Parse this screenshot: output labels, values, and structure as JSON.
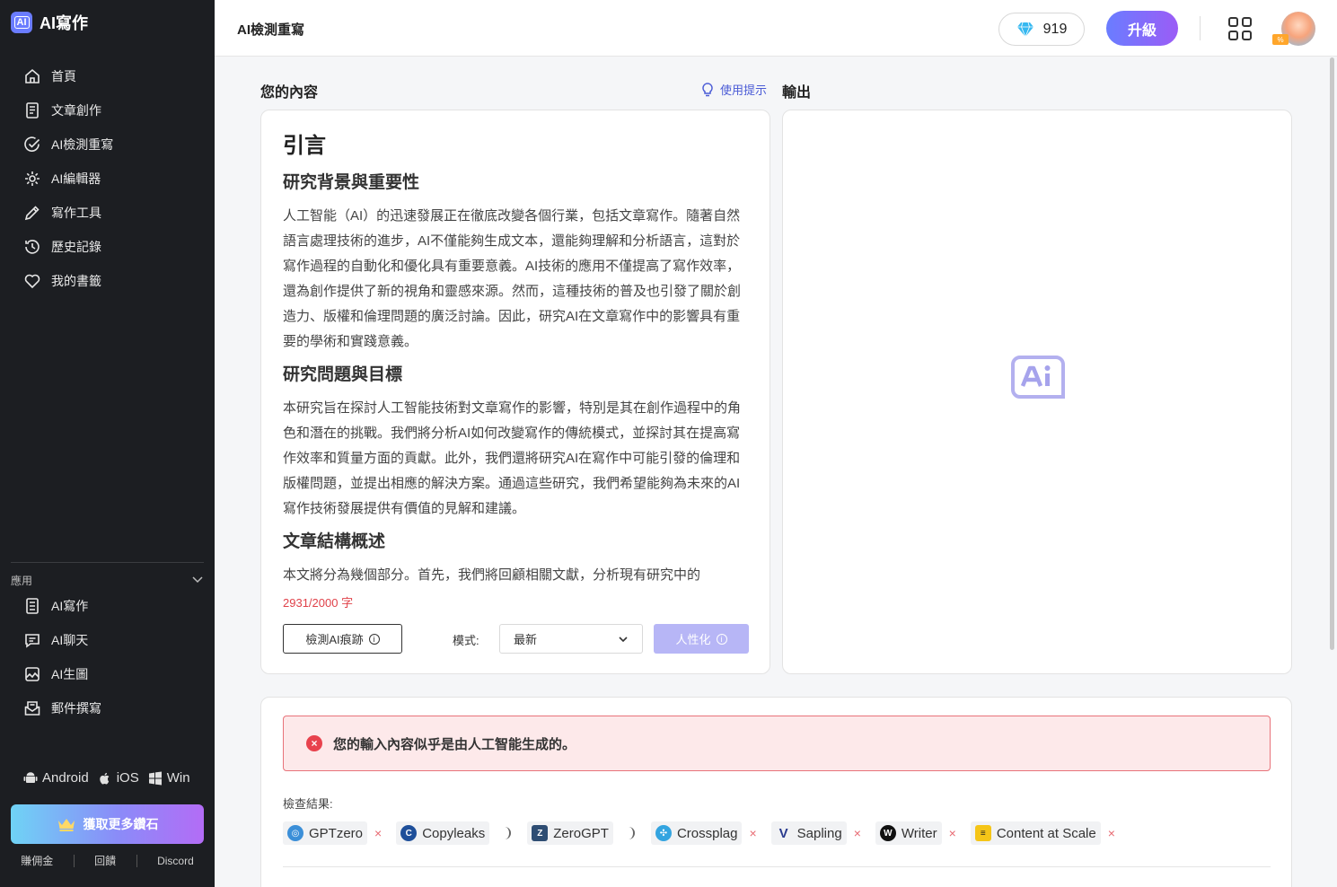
{
  "brand": {
    "name": "AI寫作",
    "logo_text": "AI"
  },
  "sidebar": {
    "items": [
      {
        "label": "首頁",
        "icon": "home-icon"
      },
      {
        "label": "文章創作",
        "icon": "document-icon"
      },
      {
        "label": "AI檢測重寫",
        "icon": "check-circle-icon"
      },
      {
        "label": "AI編輯器",
        "icon": "gear-icon"
      },
      {
        "label": "寫作工具",
        "icon": "pencil-icon"
      },
      {
        "label": "歷史記錄",
        "icon": "history-icon"
      },
      {
        "label": "我的書籤",
        "icon": "heart-icon"
      }
    ],
    "apps_header": "應用",
    "apps": [
      {
        "label": "AI寫作",
        "icon": "writing-doc-icon"
      },
      {
        "label": "AI聊天",
        "icon": "chat-icon"
      },
      {
        "label": "AI生圖",
        "icon": "image-icon"
      },
      {
        "label": "郵件撰寫",
        "icon": "mail-icon"
      }
    ],
    "platforms": [
      "Android",
      "iOS",
      "Win"
    ],
    "diamond_button": "獲取更多鑽石",
    "footer_links": [
      "賺佣金",
      "回饋",
      "Discord"
    ]
  },
  "header": {
    "title": "AI檢測重寫",
    "credits": "919",
    "upgrade": "升級",
    "avatar_badge": "%"
  },
  "main": {
    "input_label": "您的內容",
    "hint": "使用提示",
    "output_label": "輸出",
    "doc": {
      "title": "引言",
      "sections": [
        {
          "heading": "研究背景與重要性",
          "body": "人工智能（AI）的迅速發展正在徹底改變各個行業，包括文章寫作。隨著自然語言處理技術的進步，AI不僅能夠生成文本，還能夠理解和分析語言，這對於寫作過程的自動化和優化具有重要意義。AI技術的應用不僅提高了寫作效率，還為創作提供了新的視角和靈感來源。然而，這種技術的普及也引發了關於創造力、版權和倫理問題的廣泛討論。因此，研究AI在文章寫作中的影響具有重要的學術和實踐意義。"
        },
        {
          "heading": "研究問題與目標",
          "body": "本研究旨在探討人工智能技術對文章寫作的影響，特別是其在創作過程中的角色和潛在的挑戰。我們將分析AI如何改變寫作的傳統模式，並探討其在提高寫作效率和質量方面的貢獻。此外，我們還將研究AI在寫作中可能引發的倫理和版權問題，並提出相應的解決方案。通過這些研究，我們希望能夠為未來的AI寫作技術發展提供有價值的見解和建議。"
        },
        {
          "heading": "文章結構概述",
          "body": "本文將分為幾個部分。首先，我們將回顧相關文獻，分析現有研究中的"
        }
      ]
    },
    "char_count": "2931/2000 字",
    "detect_button": "檢測AI痕跡",
    "mode_label": "模式:",
    "mode_value": "最新",
    "humanize_button": "人性化",
    "info_glyph": "i"
  },
  "result": {
    "alert": "您的輸入內容似乎是由人工智能生成的。",
    "label": "檢查結果:",
    "detectors": [
      {
        "name": "GPTzero",
        "status": "fail",
        "logo_color": "#3b8fd8"
      },
      {
        "name": "Copyleaks",
        "status": "loading",
        "logo_color": "#1e4f9a"
      },
      {
        "name": "ZeroGPT",
        "status": "loading",
        "logo_color": "#2e4d73"
      },
      {
        "name": "Crossplag",
        "status": "fail",
        "logo_color": "#33a4e0"
      },
      {
        "name": "Sapling",
        "status": "fail",
        "logo_color": "#2a3b8f"
      },
      {
        "name": "Writer",
        "status": "fail",
        "logo_color": "#111111"
      },
      {
        "name": "Content at Scale",
        "status": "fail",
        "logo_color": "#f5c518"
      }
    ],
    "fail_mark": "×"
  },
  "colors": {
    "accent": "#6a7dff",
    "error": "#e8424d",
    "sidebar_bg": "#1c1e22"
  }
}
